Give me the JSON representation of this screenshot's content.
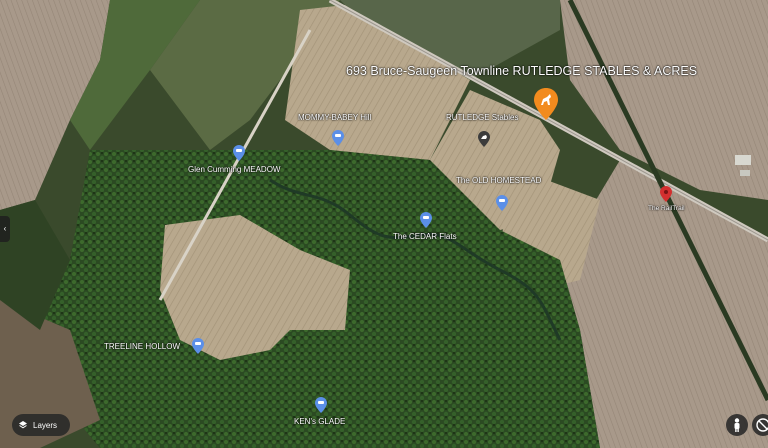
{
  "map": {
    "title": "693 Bruce-Saugeen Townline  RUTLEDGE STABLES & ACRES",
    "places": [
      {
        "label": "MOMMY-BABEY Hill"
      },
      {
        "label": "RUTLEDGE Stables"
      },
      {
        "label": "Glen Cumming MEADOW"
      },
      {
        "label": "The OLD HOMESTEAD"
      },
      {
        "label": "The CEDAR Flats"
      },
      {
        "label": "The RailTrail"
      },
      {
        "label": "TREELINE HOLLOW"
      },
      {
        "label": "KEN's GLADE"
      }
    ],
    "pin_colors": {
      "place": "#5b8fe8",
      "main": "#f28b1e",
      "rail": "#d32f2f"
    }
  },
  "controls": {
    "layers_label": "Layers",
    "layers_icon": "layers-icon",
    "pegman_icon": "pegman-icon",
    "compass_icon": "compass-icon",
    "expand_icon": "chevron-left-icon"
  }
}
